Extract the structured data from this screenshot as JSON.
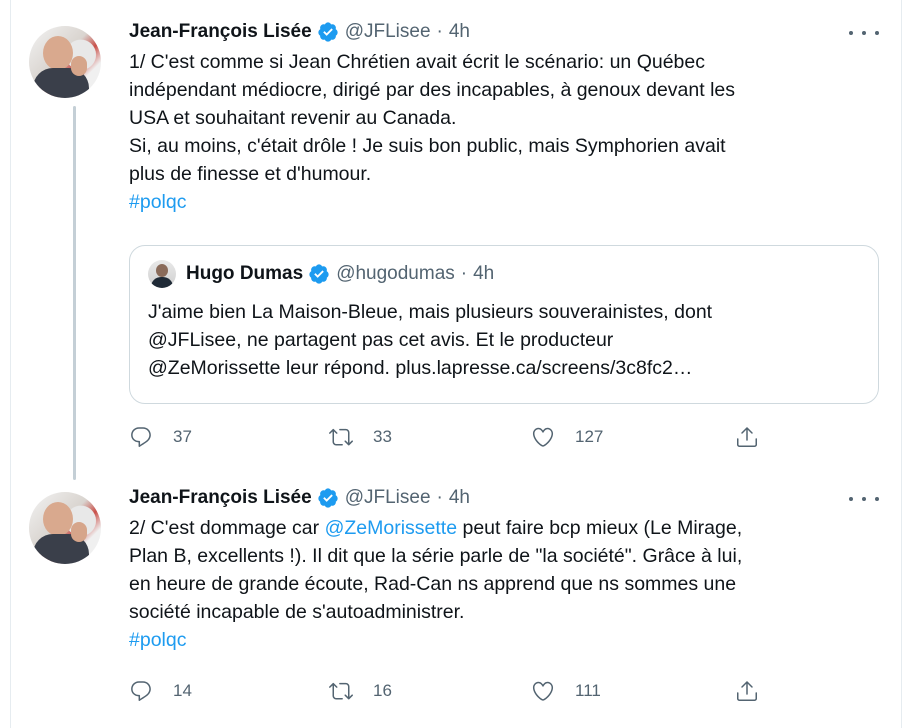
{
  "tweets": [
    {
      "author": "Jean-François Lisée",
      "handle": "@JFLisee",
      "separator": "·",
      "time": "4h",
      "lines": [
        "1/ C'est comme si Jean Chrétien avait écrit le scénario: un Québec",
        "indépendant médiocre, dirigé par des incapables, à genoux devant les",
        "USA et souhaitant revenir au Canada.",
        "Si, au moins, c'était drôle ! Je suis bon public, mais Symphorien avait",
        "plus de finesse et d'humour."
      ],
      "hashtag": "#polqc",
      "quote": {
        "author": "Hugo Dumas",
        "handle": "@hugodumas",
        "separator": "·",
        "time": "4h",
        "lines": [
          "J'aime bien La Maison-Bleue, mais plusieurs souverainistes, dont",
          "@JFLisee, ne partagent pas cet avis. Et le producteur",
          "@ZeMorissette leur répond. plus.lapresse.ca/screens/3c8fc2…"
        ]
      },
      "stats": {
        "replies": "37",
        "retweets": "33",
        "likes": "127"
      }
    },
    {
      "author": "Jean-François Lisée",
      "handle": "@JFLisee",
      "separator": "·",
      "time": "4h",
      "line1_prefix": "2/ C'est dommage car ",
      "line1_mention": "@ZeMorissette",
      "line1_suffix": " peut faire bcp mieux (Le Mirage,",
      "lines": [
        "Plan B, excellents !). Il dit que la série parle de \"la société\". Grâce à lui,",
        "en heure de grande écoute, Rad-Can ns apprend que ns sommes une",
        "société incapable de s'autoadministrer."
      ],
      "hashtag": "#polqc",
      "stats": {
        "replies": "14",
        "retweets": "16",
        "likes": "111"
      }
    }
  ],
  "colors": {
    "accent": "#1d9bf0",
    "muted": "#536471",
    "border": "#cfd9de"
  },
  "icons": [
    "verified-badge-icon",
    "more-icon",
    "reply-icon",
    "retweet-icon",
    "like-icon",
    "share-icon"
  ]
}
